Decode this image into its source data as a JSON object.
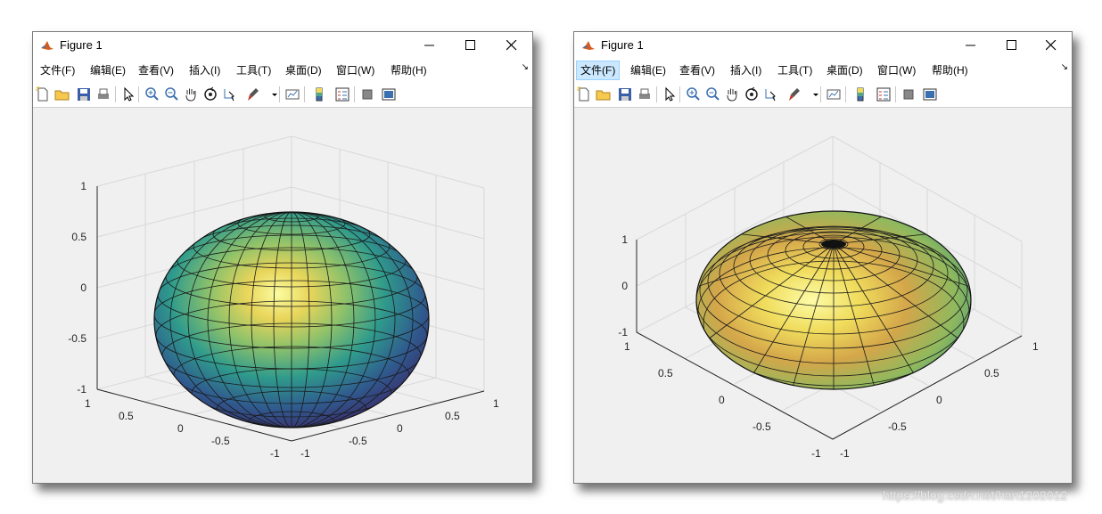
{
  "windows": [
    {
      "title": "Figure 1",
      "menus": [
        "文件(F)",
        "编辑(E)",
        "查看(V)",
        "插入(I)",
        "工具(T)",
        "桌面(D)",
        "窗口(W)",
        "帮助(H)"
      ],
      "active_menu": -1,
      "chart": {
        "z_ticks": [
          "1",
          "0.5",
          "0",
          "-0.5",
          "-1"
        ],
        "x_ticks": [
          "1",
          "0.5",
          "0",
          "-0.5",
          "-1"
        ],
        "y_ticks": [
          "-1",
          "-0.5",
          "0",
          "0.5",
          "1"
        ]
      }
    },
    {
      "title": "Figure 1",
      "menus": [
        "文件(F)",
        "编辑(E)",
        "查看(V)",
        "插入(I)",
        "工具(T)",
        "桌面(D)",
        "窗口(W)",
        "帮助(H)"
      ],
      "active_menu": 0,
      "chart": {
        "z_ticks": [
          "1",
          "0",
          "-1"
        ],
        "x_ticks": [
          "1",
          "0.5",
          "0",
          "-0.5",
          "-1"
        ],
        "y_ticks": [
          "-1",
          "-0.5",
          "0",
          "0.5",
          "1"
        ]
      }
    }
  ],
  "toolbar_icons": [
    "new-file-icon",
    "open-folder-icon",
    "save-icon",
    "print-icon",
    "pointer-icon",
    "zoom-in-icon",
    "zoom-out-icon",
    "pan-hand-icon",
    "rotate-3d-icon",
    "data-cursor-icon",
    "brush-icon",
    "dropdown-arrow-icon",
    "link-plot-icon",
    "colorbar-icon",
    "legend-icon",
    "hide-plot-tools-icon",
    "show-plot-tools-icon"
  ],
  "watermark": "https://blog.csdn.net/han1202012",
  "colors": {
    "menu_active_bg": "#cce8ff",
    "window_bg": "#f0f0f0",
    "axis_color": "#262626"
  }
}
